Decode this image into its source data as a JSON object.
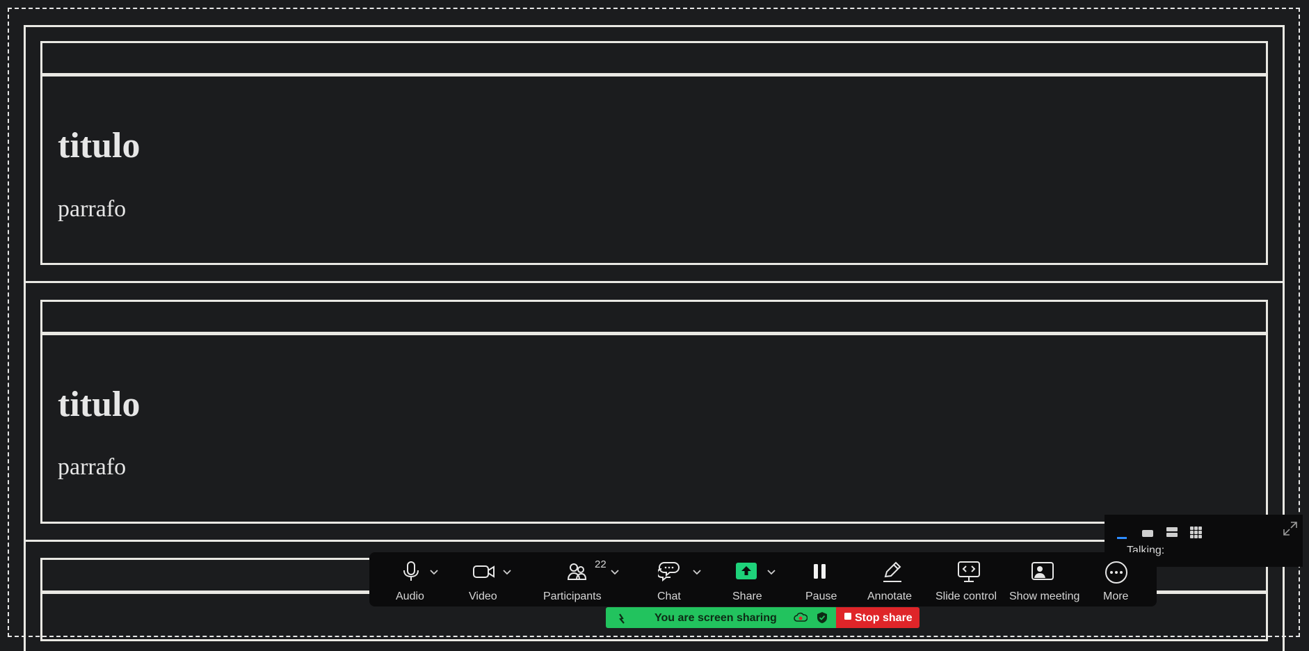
{
  "document": {
    "sections": [
      {
        "title": "titulo",
        "paragraph": "parrafo"
      },
      {
        "title": "titulo",
        "paragraph": "parrafo"
      },
      {
        "title": "",
        "paragraph": ""
      }
    ]
  },
  "toolbar": {
    "audio_label": "Audio",
    "video_label": "Video",
    "participants_label": "Participants",
    "participants_count": "22",
    "chat_label": "Chat",
    "share_label": "Share",
    "pause_label": "Pause",
    "annotate_label": "Annotate",
    "slide_control_label": "Slide control",
    "show_meeting_label": "Show meeting",
    "more_label": "More"
  },
  "sharing_bar": {
    "status_text": "You are screen sharing",
    "stop_label": "Stop share"
  },
  "video_panel": {
    "talking_label": "Talking:"
  },
  "colors": {
    "background": "#1b1c1e",
    "border": "#e9e8e3",
    "toolbar": "#0b0b0c",
    "share_green": "#22c35e",
    "share_icon_green": "#1ed27a",
    "stop_red": "#df2529",
    "active_blue": "#2d8cff"
  }
}
